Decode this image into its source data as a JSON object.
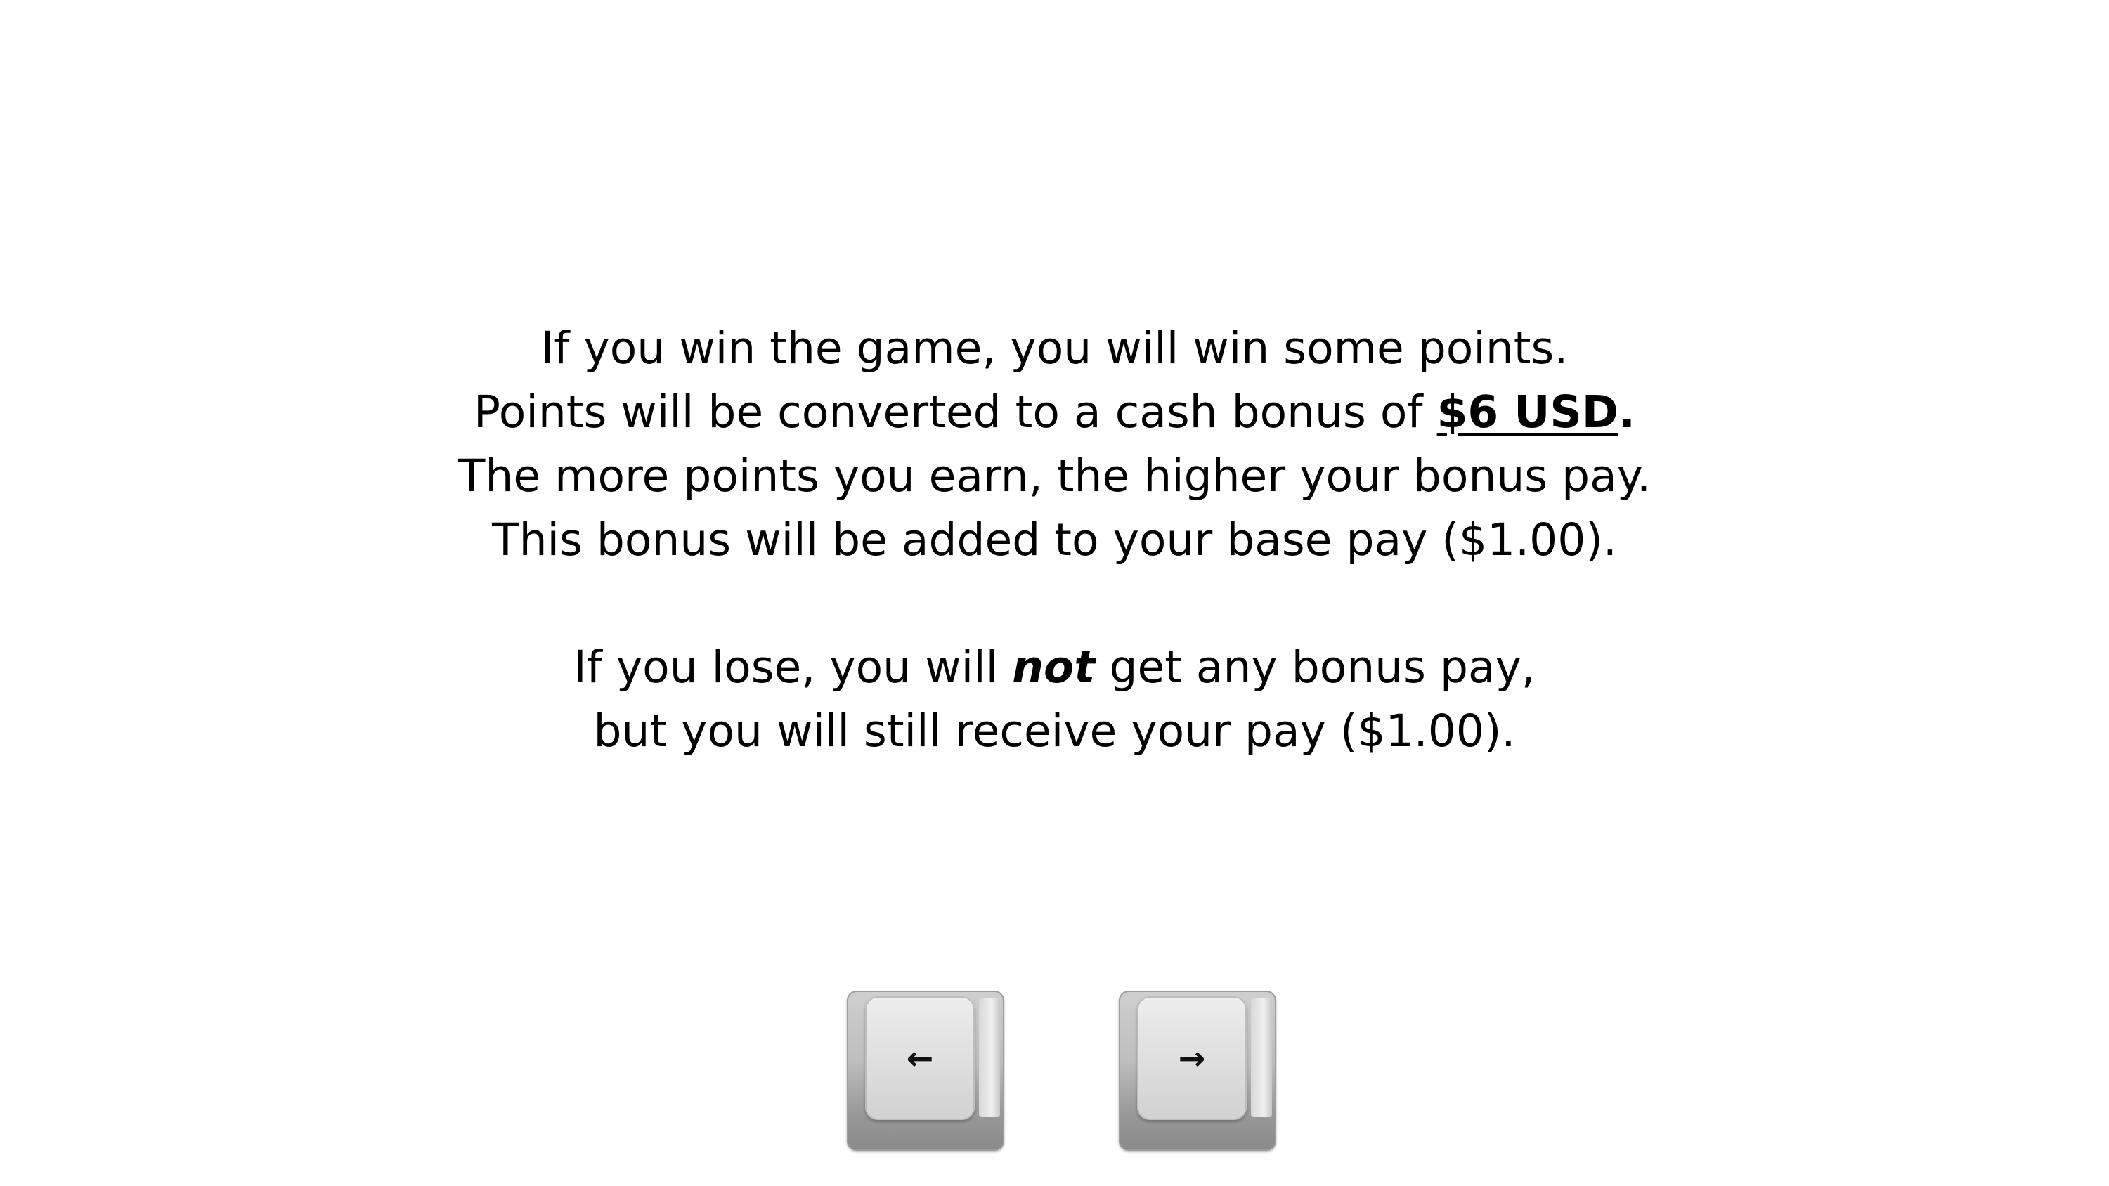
{
  "instructions": {
    "win": {
      "line1": "If you win the game, you will win some points.",
      "line2_prefix": "Points will be converted to a cash bonus of ",
      "line2_amount": "$6 USD",
      "line2_suffix": ".",
      "line3": "The more points you earn, the higher your bonus pay.",
      "line4": "This bonus will be added to your base pay ($1.00)."
    },
    "lose": {
      "line1_prefix": "If you lose, you will ",
      "line1_emphasis": "not",
      "line1_suffix": " get any bonus pay,",
      "line2": "but you will still receive your pay ($1.00)."
    }
  },
  "keys": {
    "left": {
      "icon": "left-arrow-icon",
      "glyph": "←"
    },
    "right": {
      "icon": "right-arrow-icon",
      "glyph": "→"
    }
  },
  "colors": {
    "background": "#ffffff",
    "text": "#000000",
    "key": "#bdbdbd"
  }
}
